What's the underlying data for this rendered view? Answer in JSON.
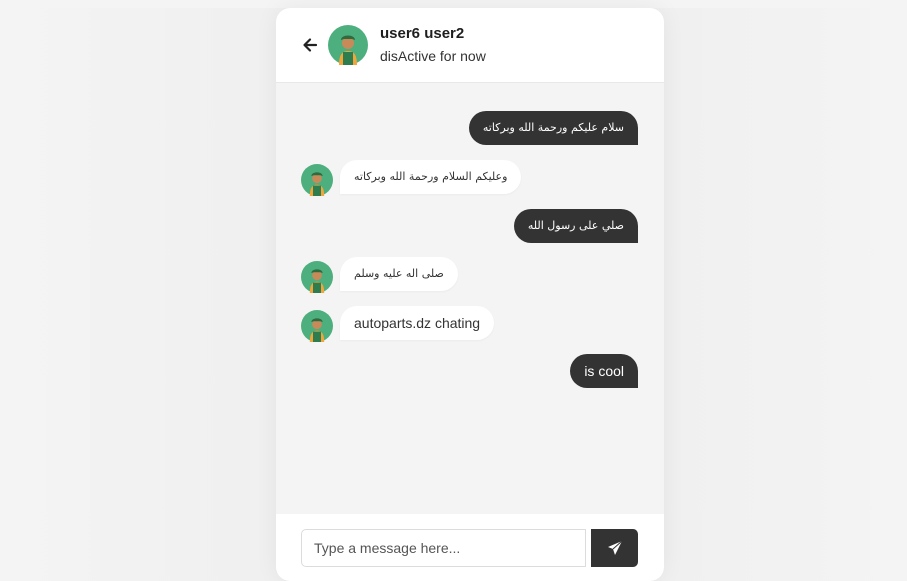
{
  "header": {
    "user_name": "user6 user2",
    "status": "disActive for now"
  },
  "messages": [
    {
      "direction": "out",
      "text": "سلام عليكم ورحمة الله وبركاته"
    },
    {
      "direction": "in",
      "text": "وعليكم السلام ورحمة الله وبركاته"
    },
    {
      "direction": "out",
      "text": "صلي على رسول الله"
    },
    {
      "direction": "in",
      "text": "صلى اله عليه وسلم"
    },
    {
      "direction": "in",
      "text": "autoparts.dz chating"
    },
    {
      "direction": "out",
      "text": "is cool"
    }
  ],
  "composer": {
    "placeholder": "Type a message here...",
    "send_icon": "paper-plane-icon"
  },
  "icons": {
    "back": "arrow-left-icon",
    "avatar": "user-avatar-icon"
  },
  "colors": {
    "page_bg": "#f4f4f4",
    "outgoing_bubble": "#333333",
    "incoming_bubble": "#ffffff",
    "avatar_bg": "#4caf7d"
  }
}
